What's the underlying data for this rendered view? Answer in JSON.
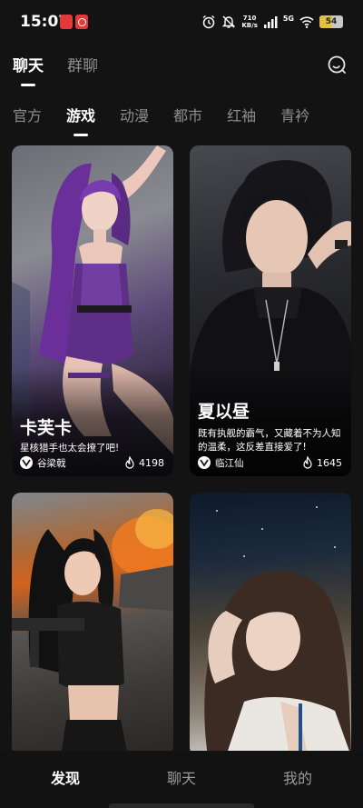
{
  "status_bar": {
    "time": "15:07",
    "network_speed_value": "710",
    "network_speed_unit": "KB/s",
    "network_type": "5G",
    "battery_level": "54",
    "battery_percent": 54
  },
  "top_tabs": [
    {
      "label": "聊天",
      "active": true
    },
    {
      "label": "群聊",
      "active": false
    }
  ],
  "category_tabs": [
    {
      "label": "官方",
      "active": false
    },
    {
      "label": "游戏",
      "active": true
    },
    {
      "label": "动漫",
      "active": false
    },
    {
      "label": "都市",
      "active": false
    },
    {
      "label": "红袖",
      "active": false
    },
    {
      "label": "青衿",
      "active": false
    }
  ],
  "cards": [
    {
      "name": "卡芙卡",
      "description": "星核猎手也太会撩了吧!",
      "author": "谷梁戟",
      "likes": "4198"
    },
    {
      "name": "夏以昼",
      "description": "既有执舰的霸气，又藏着不为人知的温柔，这反差直接爱了!",
      "author": "临江仙",
      "likes": "1645"
    },
    {
      "name": "",
      "description": "",
      "author": "",
      "likes": ""
    },
    {
      "name": "",
      "description": "",
      "author": "",
      "likes": ""
    }
  ],
  "bottom_nav": [
    {
      "label": "发现",
      "active": true
    },
    {
      "label": "聊天",
      "active": false
    },
    {
      "label": "我的",
      "active": false
    }
  ],
  "icons": {
    "search": "search-icon",
    "likes": "fire-icon",
    "author": "author-badge-icon"
  }
}
